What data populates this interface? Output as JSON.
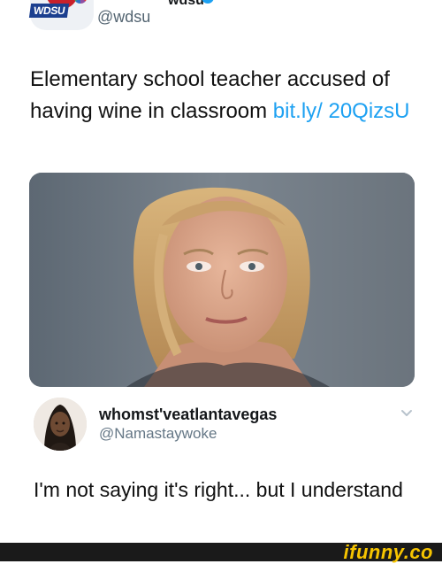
{
  "top_tweet": {
    "display_name": "wdsu",
    "handle": "@wdsu",
    "text_main": "Elementary school teacher accused of having wine in classroom ",
    "link": "bit.ly/ 20QizsU",
    "logo_text": "WDSU"
  },
  "reply": {
    "display_name": "whomst'veatlantavegas",
    "handle": "@Namastaywoke",
    "text": "I'm not saying it's right... but I understand"
  },
  "footer": {
    "watermark": "ifunny.co"
  },
  "icons": {
    "verified": "verified-badge-icon",
    "chevron": "chevron-down-icon"
  },
  "colors": {
    "link": "#1da1f2",
    "footer_bg": "#1a1a1a",
    "watermark": "#f6c400"
  }
}
